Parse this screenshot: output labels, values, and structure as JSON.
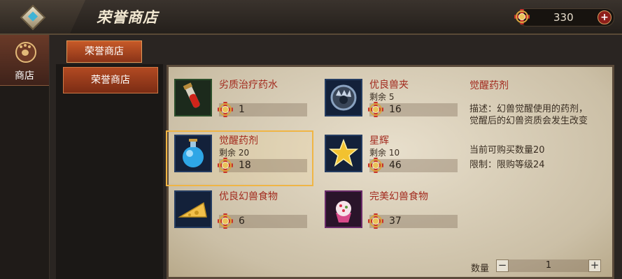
{
  "header": {
    "title": "荣誉商店",
    "currency_value": "330",
    "add_label": "+"
  },
  "sidebar": {
    "shop_label": "商店"
  },
  "tabs": {
    "active_tab": "荣誉商店"
  },
  "categories": [
    {
      "label": "荣誉商店"
    }
  ],
  "items": [
    {
      "name": "劣质治疗药水",
      "remaining": "",
      "price": "1",
      "icon": "red-potion-icon"
    },
    {
      "name": "优良兽夹",
      "remaining": "剩余 5",
      "price": "16",
      "icon": "beast-trap-icon"
    },
    {
      "name": "觉醒药剂",
      "remaining": "剩余 20",
      "price": "18",
      "icon": "blue-potion-icon"
    },
    {
      "name": "星辉",
      "remaining": "剩余 10",
      "price": "46",
      "icon": "star-icon"
    },
    {
      "name": "优良幻兽食物",
      "remaining": "",
      "price": "6",
      "icon": "cheese-icon"
    },
    {
      "name": "完美幻兽食物",
      "remaining": "",
      "price": "37",
      "icon": "cupcake-icon"
    }
  ],
  "detail": {
    "title": "觉醒药剂",
    "description": "描述：幻兽觉醒使用的药剂，觉醒后的幻兽资质会发生改变",
    "buy_limit": "当前可购买数量20",
    "restriction": "限制：限购等级24",
    "quantity_label": "数量",
    "quantity": "1",
    "minus_label": "−",
    "plus_label": "+"
  }
}
